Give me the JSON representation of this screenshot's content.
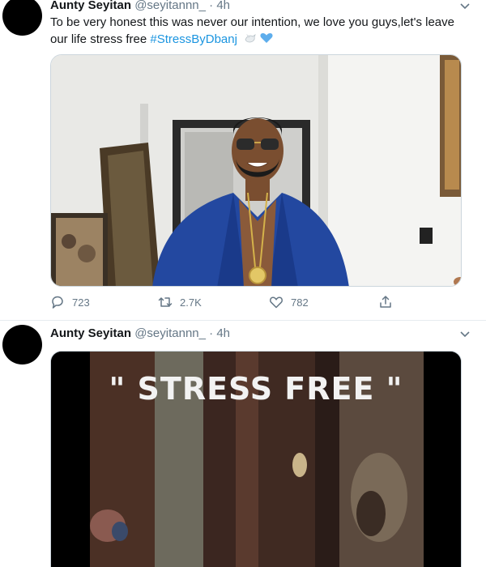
{
  "tweets": [
    {
      "name": "Aunty Seyitan",
      "handle": "@seyitannn_",
      "dot": "·",
      "time": "4h",
      "text_before": "To be very honest this was never our intention, we love you guys,let's leave our life stress free ",
      "hashtag": "#StressByDbanj",
      "emoji_icons": [
        "dove-emoji",
        "blue-heart-emoji"
      ],
      "actions": {
        "reply": "723",
        "retweet": "2.7K",
        "like": "782"
      }
    },
    {
      "name": "Aunty Seyitan",
      "handle": "@seyitannn_",
      "dot": "·",
      "time": "4h",
      "video_caption": "\" STRESS FREE \""
    }
  ],
  "colors": {
    "link": "#1b95e0",
    "muted": "#657786",
    "jacket": "#2348a0"
  }
}
